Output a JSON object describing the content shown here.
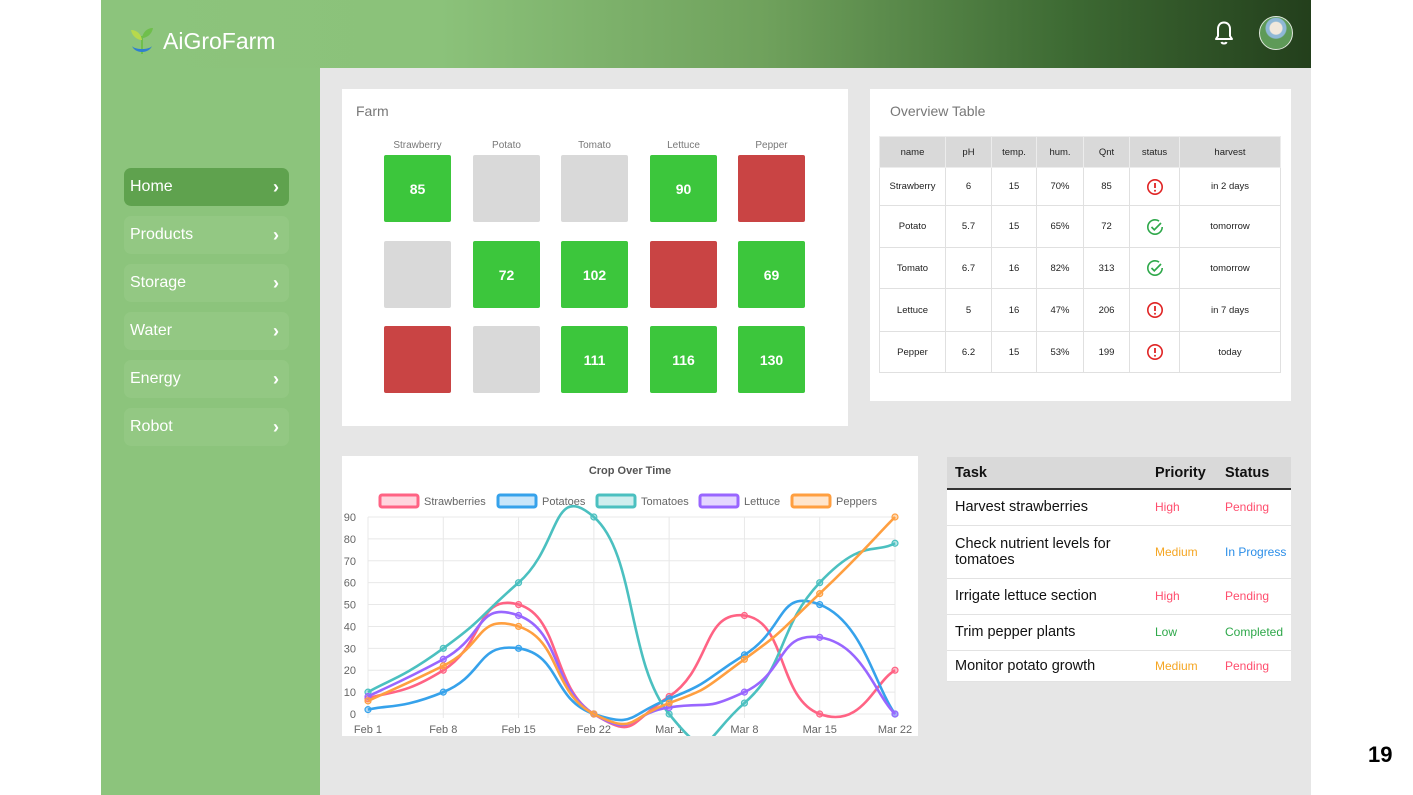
{
  "app": {
    "name": "AiGroFarm"
  },
  "colors": {
    "sidebar": "#8cc47c",
    "active_nav": "#5fa24e",
    "good": "#3cc63c",
    "bad": "#c94444",
    "empty": "#d9d9d9"
  },
  "sidebar": {
    "items": [
      {
        "label": "Home",
        "active": true
      },
      {
        "label": "Products",
        "active": false
      },
      {
        "label": "Storage",
        "active": false
      },
      {
        "label": "Water",
        "active": false
      },
      {
        "label": "Energy",
        "active": false
      },
      {
        "label": "Robot",
        "active": false
      }
    ],
    "chevron": "›"
  },
  "farm": {
    "title": "Farm",
    "columns": [
      "Strawberry",
      "Potato",
      "Tomato",
      "Lettuce",
      "Pepper"
    ],
    "grid": [
      [
        {
          "state": "green",
          "value": "85"
        },
        {
          "state": "gray",
          "value": ""
        },
        {
          "state": "gray",
          "value": ""
        },
        {
          "state": "green",
          "value": "90"
        },
        {
          "state": "red",
          "value": ""
        }
      ],
      [
        {
          "state": "gray",
          "value": ""
        },
        {
          "state": "green",
          "value": "72"
        },
        {
          "state": "green",
          "value": "102"
        },
        {
          "state": "red",
          "value": ""
        },
        {
          "state": "green",
          "value": "69"
        }
      ],
      [
        {
          "state": "red",
          "value": ""
        },
        {
          "state": "gray",
          "value": ""
        },
        {
          "state": "green",
          "value": "111"
        },
        {
          "state": "green",
          "value": "116"
        },
        {
          "state": "green",
          "value": "130"
        }
      ]
    ]
  },
  "overview": {
    "title": "Overview Table",
    "headers": [
      "name",
      "pH",
      "temp.",
      "hum.",
      "Qnt",
      "status",
      "harvest"
    ],
    "rows": [
      {
        "name": "Strawberry",
        "ph": "6",
        "temp": "15",
        "hum": "70%",
        "qnt": "85",
        "status": "alert-icon",
        "harvest": "in 2 days"
      },
      {
        "name": "Potato",
        "ph": "5.7",
        "temp": "15",
        "hum": "65%",
        "qnt": "72",
        "status": "check-icon",
        "harvest": "tomorrow"
      },
      {
        "name": "Tomato",
        "ph": "6.7",
        "temp": "16",
        "hum": "82%",
        "qnt": "313",
        "status": "check-icon",
        "harvest": "tomorrow"
      },
      {
        "name": "Lettuce",
        "ph": "5",
        "temp": "16",
        "hum": "47%",
        "qnt": "206",
        "status": "alert-icon",
        "harvest": "in 7 days"
      },
      {
        "name": "Pepper",
        "ph": "6.2",
        "temp": "15",
        "hum": "53%",
        "qnt": "199",
        "status": "alert-icon",
        "harvest": "today"
      }
    ]
  },
  "tasks": {
    "headers": [
      "Task",
      "Priority",
      "Status"
    ],
    "rows": [
      {
        "task": "Harvest strawberries",
        "priority": "High",
        "status": "Pending"
      },
      {
        "task": "Check nutrient levels for tomatoes",
        "priority": "Medium",
        "status": "In Progress"
      },
      {
        "task": "Irrigate lettuce section",
        "priority": "High",
        "status": "Pending"
      },
      {
        "task": "Trim pepper plants",
        "priority": "Low",
        "status": "Completed"
      },
      {
        "task": "Monitor potato growth",
        "priority": "Medium",
        "status": "Pending"
      }
    ],
    "priority_colors": {
      "High": "#ff4d6d",
      "Medium": "#f5a623",
      "Low": "#2ea84a"
    },
    "status_colors": {
      "Pending": "#ff4d6d",
      "In Progress": "#2b8ee8",
      "Completed": "#2ea84a"
    }
  },
  "page_number": "19",
  "chart_data": {
    "type": "line",
    "title": "Crop Over Time",
    "x": [
      "Feb 1",
      "Feb 8",
      "Feb 15",
      "Feb 22",
      "Mar 1",
      "Mar 8",
      "Mar 15",
      "Mar 22"
    ],
    "ylim": [
      0,
      90
    ],
    "yticks": [
      0,
      10,
      20,
      30,
      40,
      50,
      60,
      70,
      80,
      90
    ],
    "grid": true,
    "legend": "top",
    "series": [
      {
        "name": "Strawberries",
        "color": "#ff6384",
        "values": [
          7,
          20,
          50,
          0,
          8,
          45,
          0,
          20
        ]
      },
      {
        "name": "Potatoes",
        "color": "#36a2eb",
        "values": [
          2,
          10,
          30,
          0,
          7,
          27,
          50,
          0
        ]
      },
      {
        "name": "Tomatoes",
        "color": "#4bc0c0",
        "values": [
          10,
          30,
          60,
          90,
          0,
          5,
          60,
          78
        ]
      },
      {
        "name": "Lettuce",
        "color": "#9966ff",
        "values": [
          8,
          25,
          45,
          0,
          3,
          10,
          35,
          0
        ]
      },
      {
        "name": "Peppers",
        "color": "#ff9f40",
        "values": [
          6,
          22,
          40,
          0,
          5,
          25,
          55,
          90
        ]
      }
    ]
  }
}
